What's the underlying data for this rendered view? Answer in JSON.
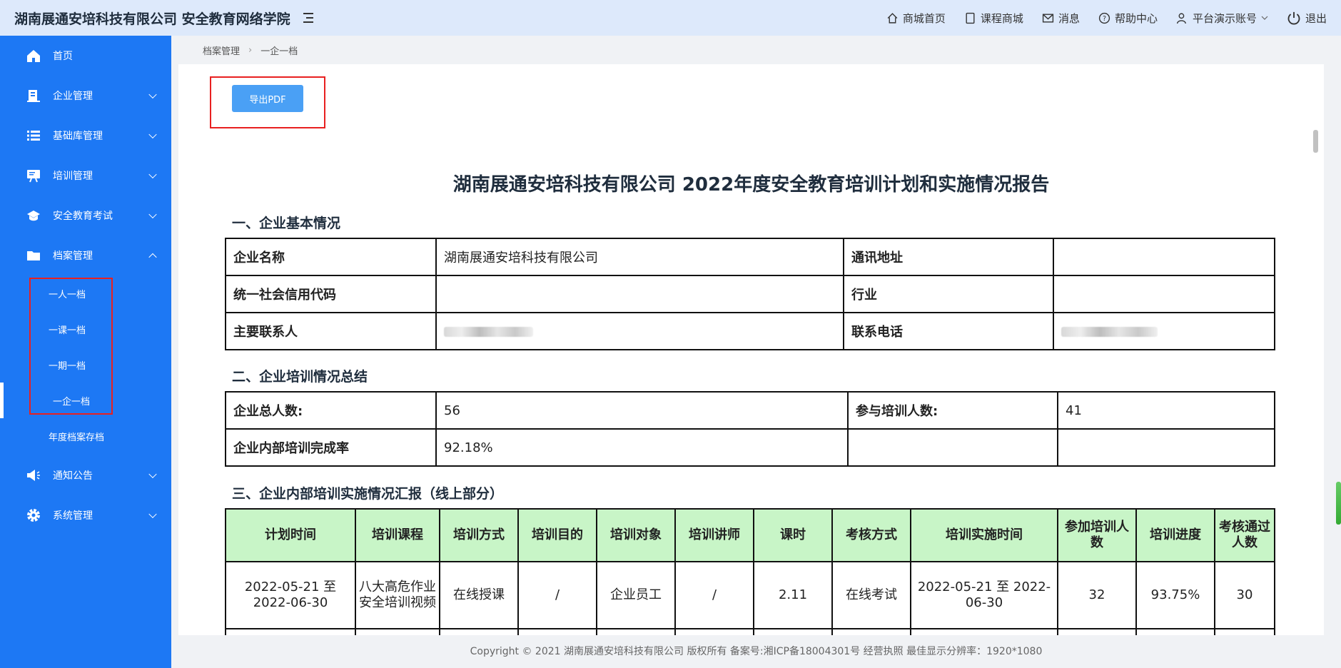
{
  "header": {
    "title": "湖南展通安培科技有限公司 安全教育网络学院",
    "nav": [
      "商城首页",
      "课程商城",
      "消息",
      "帮助中心",
      "平台演示账号",
      "退出"
    ]
  },
  "sidebar": {
    "items": [
      {
        "label": "首页",
        "icon": "home-icon"
      },
      {
        "label": "企业管理",
        "icon": "building-icon"
      },
      {
        "label": "基础库管理",
        "icon": "list-icon"
      },
      {
        "label": "培训管理",
        "icon": "presentation-icon"
      },
      {
        "label": "安全教育考试",
        "icon": "exam-icon"
      },
      {
        "label": "档案管理",
        "icon": "folder-icon"
      },
      {
        "label": "通知公告",
        "icon": "megaphone-icon"
      },
      {
        "label": "系统管理",
        "icon": "gear-icon"
      }
    ],
    "sub": [
      "一人一档",
      "一课一档",
      "一期一档",
      "一企一档",
      "年度档案存档"
    ]
  },
  "breadcrumb": [
    "档案管理",
    "一企一档"
  ],
  "export_label": "导出PDF",
  "report": {
    "title": "湖南展通安培科技有限公司 2022年度安全教育培训计划和实施情况报告",
    "sec1": "一、企业基本情况",
    "sec2": "二、企业培训情况总结",
    "sec3": "三、企业内部培训实施情况汇报（线上部分）",
    "basic": {
      "name_label": "企业名称",
      "name": "湖南展通安培科技有限公司",
      "addr_label": "通讯地址",
      "addr": "",
      "code_label": "统一社会信用代码",
      "code": "",
      "industry_label": "行业",
      "industry": "",
      "contact_label": "主要联系人",
      "phone_label": "联系电话"
    },
    "summary": {
      "total_label": "企业总人数:",
      "total": "56",
      "trained_label": "参与培训人数:",
      "trained": "41",
      "rate_label": "企业内部培训完成率",
      "rate": "92.18%"
    },
    "plan_headers": [
      "计划时间",
      "培训课程",
      "培训方式",
      "培训目的",
      "培训对象",
      "培训讲师",
      "课时",
      "考核方式",
      "培训实施时间",
      "参加培训人数",
      "培训进度",
      "考核通过人数"
    ],
    "plan_row": [
      "2022-05-21 至 2022-06-30",
      "八大高危作业安全培训视频",
      "在线授课",
      "/",
      "企业员工",
      "/",
      "2.11",
      "在线考试",
      "2022-05-21 至 2022-06-30",
      "32",
      "93.75%",
      "30"
    ]
  },
  "footer": "Copyright © 2021 湖南展通安培科技有限公司 版权所有 备案号:湘ICP备18004301号 经营执照 最佳显示分辨率：1920*1080"
}
